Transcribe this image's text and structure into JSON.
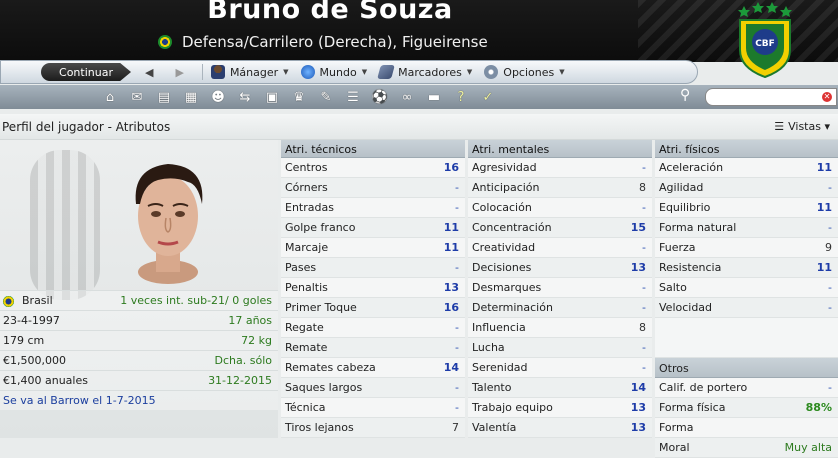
{
  "header": {
    "name": "Bruno de Souza",
    "subtitle": "Defensa/Carrilero (Derecha), Figueirense",
    "crest_text": "CBF"
  },
  "nav": {
    "continue": "Continuar",
    "items": [
      {
        "label": "Mánager",
        "icon": "manager-icon"
      },
      {
        "label": "Mundo",
        "icon": "globe-icon"
      },
      {
        "label": "Marcadores",
        "icon": "bookmark-icon"
      },
      {
        "label": "Opciones",
        "icon": "options-icon"
      }
    ]
  },
  "page": {
    "title": "Perfil del jugador - Atributos",
    "views": "Vistas"
  },
  "info": [
    {
      "left": "Brasil",
      "right": "1 veces int. sub-21/ 0 goles"
    },
    {
      "left": "23-4-1997",
      "right": "17 años"
    },
    {
      "left": "179 cm",
      "right": "72 kg"
    },
    {
      "left": "€1,500,000",
      "right": "Dcha. sólo"
    },
    {
      "left": "€1,400 anuales",
      "right": "31-12-2015"
    },
    {
      "left": "Se va al Barrow el 1-7-2015",
      "right": ""
    }
  ],
  "technical": {
    "title": "Atri. técnicos",
    "rows": [
      {
        "label": "Centros",
        "value": "16"
      },
      {
        "label": "Córners",
        "value": "-"
      },
      {
        "label": "Entradas",
        "value": "-"
      },
      {
        "label": "Golpe franco",
        "value": "11"
      },
      {
        "label": "Marcaje",
        "value": "11"
      },
      {
        "label": "Pases",
        "value": "-"
      },
      {
        "label": "Penaltis",
        "value": "13"
      },
      {
        "label": "Primer Toque",
        "value": "16"
      },
      {
        "label": "Regate",
        "value": "-"
      },
      {
        "label": "Remate",
        "value": "-"
      },
      {
        "label": "Remates cabeza",
        "value": "14"
      },
      {
        "label": "Saques largos",
        "value": "-"
      },
      {
        "label": "Técnica",
        "value": "-"
      },
      {
        "label": "Tiros lejanos",
        "value": "7"
      }
    ]
  },
  "mental": {
    "title": "Atri. mentales",
    "rows": [
      {
        "label": "Agresividad",
        "value": "-"
      },
      {
        "label": "Anticipación",
        "value": "8"
      },
      {
        "label": "Colocación",
        "value": "-"
      },
      {
        "label": "Concentración",
        "value": "15"
      },
      {
        "label": "Creatividad",
        "value": "-"
      },
      {
        "label": "Decisiones",
        "value": "13"
      },
      {
        "label": "Desmarques",
        "value": "-"
      },
      {
        "label": "Determinación",
        "value": "-"
      },
      {
        "label": "Influencia",
        "value": "8"
      },
      {
        "label": "Lucha",
        "value": "-"
      },
      {
        "label": "Serenidad",
        "value": "-"
      },
      {
        "label": "Talento",
        "value": "14"
      },
      {
        "label": "Trabajo equipo",
        "value": "13"
      },
      {
        "label": "Valentía",
        "value": "13"
      }
    ]
  },
  "physical": {
    "title": "Atri. físicos",
    "rows": [
      {
        "label": "Aceleración",
        "value": "11"
      },
      {
        "label": "Agilidad",
        "value": "-"
      },
      {
        "label": "Equilibrio",
        "value": "11"
      },
      {
        "label": "Forma natural",
        "value": "-"
      },
      {
        "label": "Fuerza",
        "value": "9"
      },
      {
        "label": "Resistencia",
        "value": "11"
      },
      {
        "label": "Salto",
        "value": "-"
      },
      {
        "label": "Velocidad",
        "value": "-"
      }
    ]
  },
  "other": {
    "title": "Otros",
    "rows": [
      {
        "label": "Calif. de portero",
        "value": "-"
      },
      {
        "label": "Forma física",
        "value": "88%"
      },
      {
        "label": "Forma",
        "value": ""
      },
      {
        "label": "Moral",
        "value": "Muy alta"
      }
    ]
  },
  "colors": {
    "highlight_value": "#1e3ca8",
    "positive_text": "#2c7a1e",
    "header_bg": "#111111"
  }
}
